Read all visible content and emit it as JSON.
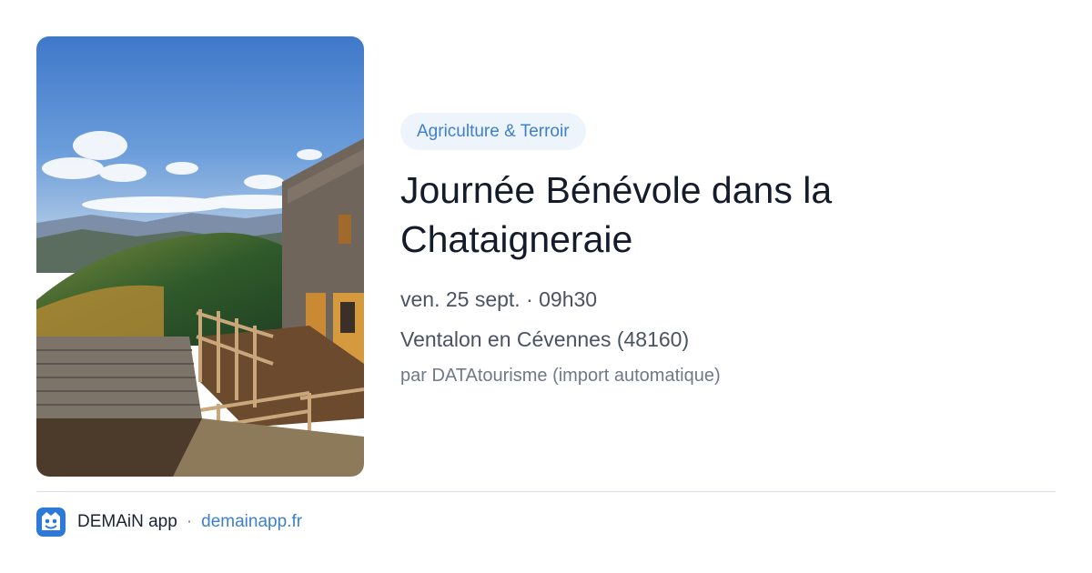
{
  "card": {
    "image_alt": "Refuge en pierre avec terrasse en bois dominant les montagnes des Cévennes",
    "category": "Agriculture & Terroir",
    "title": "Journée Bénévole dans la Chataigneraie",
    "date": "ven. 25 sept. · 09h30",
    "location": "Ventalon en Cévennes (48160)",
    "source": "par DATAtourisme (import automatique)"
  },
  "footer": {
    "app_name": "DEMAiN app",
    "separator": "·",
    "url": "demainapp.fr",
    "logo_icon": "demain-app-logo-icon"
  },
  "colors": {
    "accent": "#3d7fd0",
    "tag_background": "#eef4fb",
    "title": "#141b2b",
    "meta": "#4a5263",
    "divider": "#d6dde4"
  }
}
